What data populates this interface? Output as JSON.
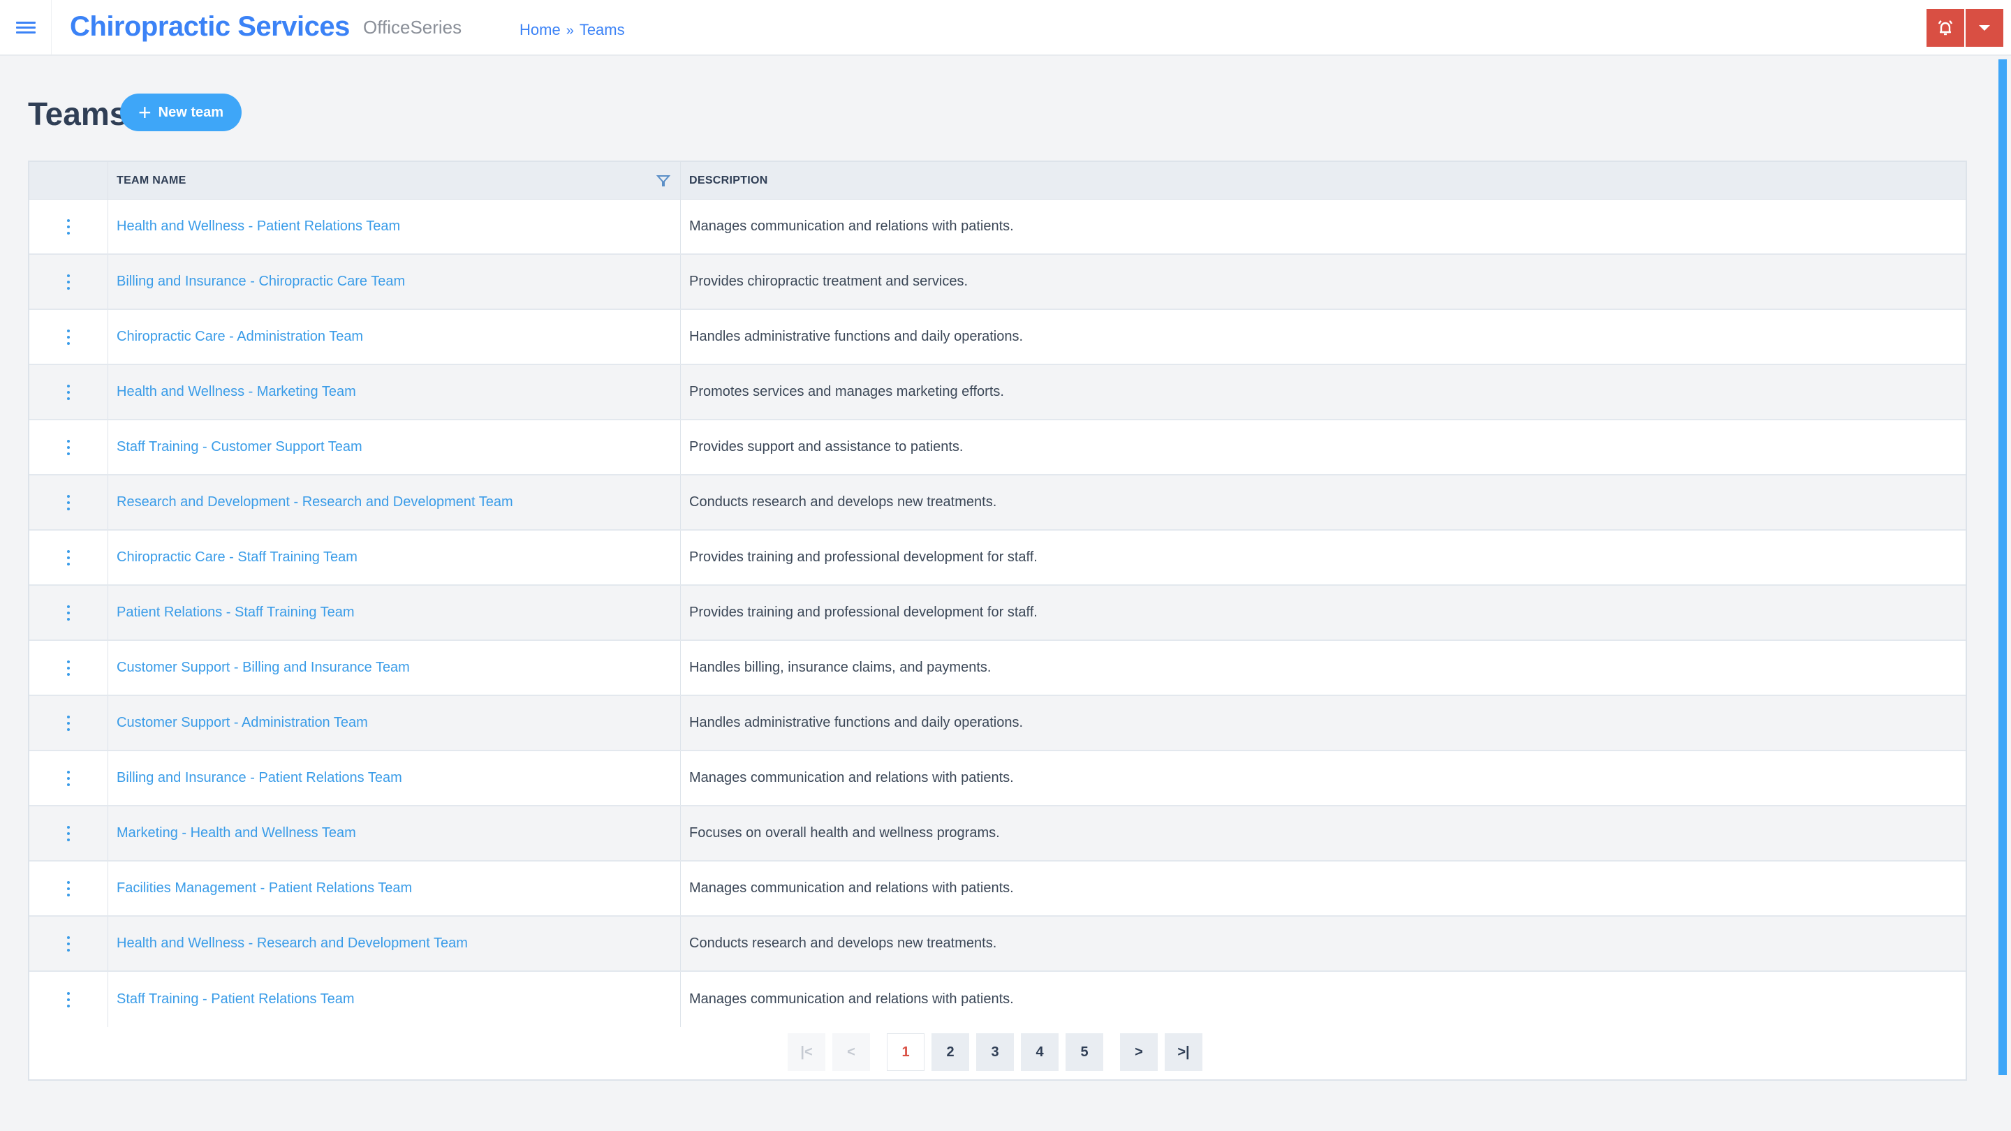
{
  "header": {
    "app_title": "Chiropractic Services",
    "app_subtitle": "OfficeSeries",
    "breadcrumb": [
      {
        "label": "Home"
      },
      {
        "separator": "»"
      },
      {
        "label": "Teams"
      }
    ],
    "icons": {
      "menu": "hamburger-icon",
      "notifications": "bell-icon",
      "dropdown": "caret-down-icon"
    },
    "accent_color": "#3b82f6",
    "alert_color": "#d94f43"
  },
  "page": {
    "title": "Teams",
    "new_button_label": "New team",
    "new_button_icon": "plus-icon"
  },
  "table": {
    "columns": [
      {
        "label": ""
      },
      {
        "label": "TEAM NAME",
        "filter_icon": "filter-icon"
      },
      {
        "label": "DESCRIPTION"
      }
    ],
    "rows": [
      {
        "name": "Health and Wellness - Patient Relations Team",
        "description": "Manages communication and relations with patients."
      },
      {
        "name": "Billing and Insurance - Chiropractic Care Team",
        "description": "Provides chiropractic treatment and services."
      },
      {
        "name": "Chiropractic Care - Administration Team",
        "description": "Handles administrative functions and daily operations."
      },
      {
        "name": "Health and Wellness - Marketing Team",
        "description": "Promotes services and manages marketing efforts."
      },
      {
        "name": "Staff Training - Customer Support Team",
        "description": "Provides support and assistance to patients."
      },
      {
        "name": "Research and Development - Research and Development Team",
        "description": "Conducts research and develops new treatments."
      },
      {
        "name": "Chiropractic Care - Staff Training Team",
        "description": "Provides training and professional development for staff."
      },
      {
        "name": "Patient Relations - Staff Training Team",
        "description": "Provides training and professional development for staff."
      },
      {
        "name": "Customer Support - Billing and Insurance Team",
        "description": "Handles billing, insurance claims, and payments."
      },
      {
        "name": "Customer Support - Administration Team",
        "description": "Handles administrative functions and daily operations."
      },
      {
        "name": "Billing and Insurance - Patient Relations Team",
        "description": "Manages communication and relations with patients."
      },
      {
        "name": "Marketing - Health and Wellness Team",
        "description": "Focuses on overall health and wellness programs."
      },
      {
        "name": "Facilities Management - Patient Relations Team",
        "description": "Manages communication and relations with patients."
      },
      {
        "name": "Health and Wellness - Research and Development Team",
        "description": "Conducts research and develops new treatments."
      },
      {
        "name": "Staff Training - Patient Relations Team",
        "description": "Manages communication and relations with patients."
      }
    ]
  },
  "pagination": {
    "first_label": "|<",
    "prev_label": "<",
    "pages": [
      "1",
      "2",
      "3",
      "4",
      "5"
    ],
    "current_page": "1",
    "next_label": ">",
    "last_label": ">|"
  }
}
